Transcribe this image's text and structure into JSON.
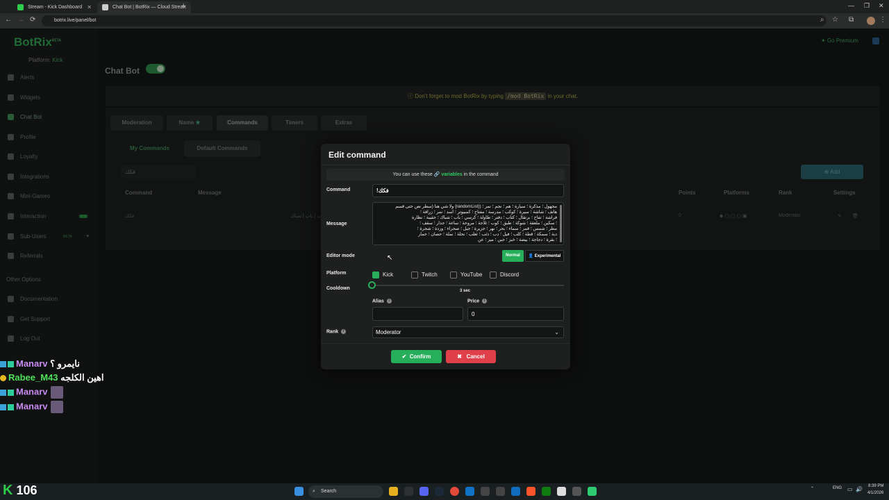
{
  "browser": {
    "tabs": [
      {
        "title": "Stream - Kick Dashboard",
        "favicon_color": "#2ecc4a"
      },
      {
        "title": "Chat Bot | BotRix — Cloud Strea",
        "favicon_color": "#cccccc"
      }
    ],
    "new_tab": "+",
    "url": "botrix.live/panel/bot"
  },
  "sidebar": {
    "logo": "BotRix",
    "logo_sup": "BETA",
    "platform_label": "Platform:",
    "platform_value": "Kick",
    "items": [
      {
        "label": "Alerts"
      },
      {
        "label": "Widgets"
      },
      {
        "label": "Chat Bot"
      },
      {
        "label": "Profile"
      },
      {
        "label": "Loyalty"
      },
      {
        "label": "Integrations"
      },
      {
        "label": "Mini-Games"
      },
      {
        "label": "Interaction"
      },
      {
        "label": "Sub-Users"
      },
      {
        "label": "Referrals"
      }
    ],
    "sub_users_badge": "BETA",
    "other_options": "Other Options",
    "other_items": [
      {
        "label": "Documentation"
      },
      {
        "label": "Get Support"
      },
      {
        "label": "Log Out"
      }
    ]
  },
  "header": {
    "title": "Chat Bot",
    "premium": "Go Premium"
  },
  "notice": {
    "before": "Don't forget to mod BotRix by typing",
    "code": "/mod BotRix",
    "after": "in your chat."
  },
  "tabs": [
    "Moderation",
    "Name",
    "Commands",
    "Timers",
    "Extras"
  ],
  "subtabs": [
    "My Commands",
    "Default Commands"
  ],
  "search_value": "فكك",
  "add_button": "Add",
  "table": {
    "headers": [
      "Command",
      "Message",
      "Points",
      "Platforms",
      "Rank",
      "Settings"
    ],
    "row": {
      "command": "فكك",
      "message": "زرافة | سيارة | ساعة | بحر | سفينة | نجمة | سماء | قمر | شمس | جبل | شجرة | وردة | بيت | باب | شباك",
      "points": "0",
      "rank": "Moderator"
    }
  },
  "modal": {
    "title": "Edit command",
    "var_prefix": "You can use these",
    "var_link": "variables",
    "var_suffix": "in the command",
    "command_label": "Command",
    "command_value": "!فكك",
    "message_label": "Message",
    "message_lines": [
      "مجهول ؛ مذكرة ؛ سيارة ؛ هم ؛ نجم ؛ نمر ؛ ((randomList} ولا شي هنا (سطر نص حتى قسم",
      "هاتف ؛ شاشة ؛ سيرة ؛ كوكب ؛ مدرسة ؛ مفتاح ؛ كمبيوتر ؛ أسد ؛ نمر ؛ زرافة ؛",
      "فراشة ؛ تفاح ؛ برتقال ؛ كتاب ؛ دفتر ؛ طاولة ؛ كرسي ؛ باب ؛ شباك ؛ حقيبة ؛ نظارة",
      "؛ سكين ؛ ملعقة ؛ شوكة ؛ طبق ؛ كوب ؛ ثلاجة ؛ مروحة ؛ ساعة ؛ جدار ؛ سقف ؛",
      "مطر ؛ شمس ؛ قمر ؛ سماء ؛ بحر ؛ نهر ؛ جزيرة ؛ جبل ؛ صحراء ؛ وردة ؛ شجرة ؛",
      "دبة ؛ سمكة ؛ قطة ؛ كلب ؛ فيل ؛ دب ؛ ذئب ؛ ثعلب ؛ نحلة ؛ نملة ؛ حصان ؛ حمار",
      "؛ بقرة ؛ دجاجة ؛ بيضة ؛ خبز ؛ جبن ؛ ميز ؛ عن"
    ],
    "editor_mode_label": "Editor mode",
    "mode_normal": "Normal",
    "mode_experimental": "Experimental",
    "platform_label": "Platform",
    "platforms": [
      {
        "name": "Kick",
        "checked": true
      },
      {
        "name": "Twitch",
        "checked": false
      },
      {
        "name": "YouTube",
        "checked": false
      },
      {
        "name": "Discord",
        "checked": false
      }
    ],
    "cooldown_label": "Cooldown",
    "cooldown_value": "3 sec",
    "cooldown_seconds": 3,
    "alias_label": "Alias",
    "alias_value": "",
    "price_label": "Price",
    "price_value": "0",
    "rank_label": "Rank",
    "rank_value": "Moderator",
    "confirm": "Confirm",
    "cancel": "Cancel"
  },
  "chat_overlay": [
    {
      "user": "Manarv",
      "message": "نايمرو ؟",
      "color": "#c98bf0"
    },
    {
      "user": "Rabee_M43",
      "message": "اهين الكلجه",
      "color": "#4fe05a"
    },
    {
      "user": "Manarv",
      "message": "",
      "color": "#c98bf0"
    },
    {
      "user": "Manarv",
      "message": "",
      "color": "#c98bf0"
    }
  ],
  "viewer_count": "106",
  "taskbar": {
    "search": "Search",
    "lang": "ENG",
    "time": "8:39 PM",
    "date": "4/1/2026"
  }
}
